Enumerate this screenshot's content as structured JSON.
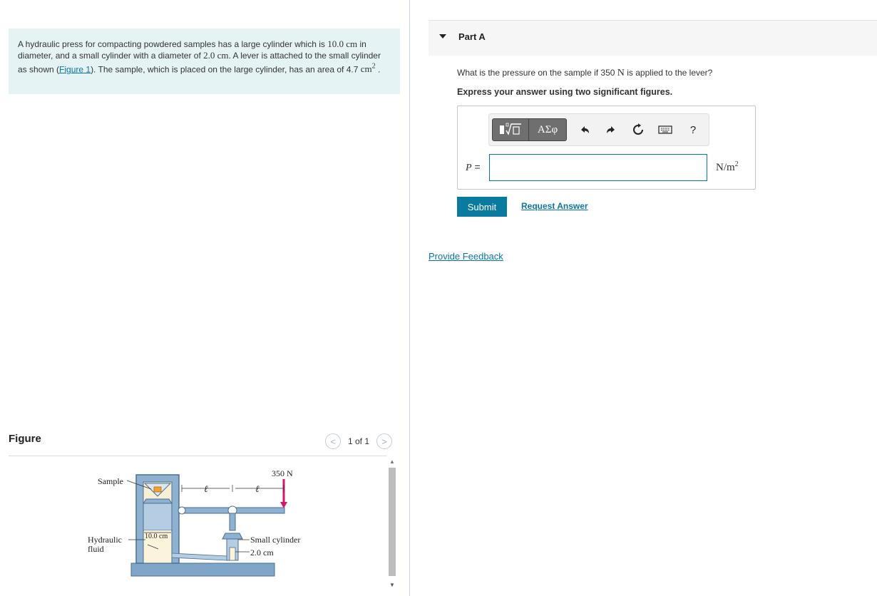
{
  "problem": {
    "text1": "A hydraulic press for compacting powdered samples has a large cylinder which is ",
    "large_diameter": "10.0 cm",
    "text2": " in diameter, and a small cylinder with a diameter of ",
    "small_diameter": "2.0 cm",
    "text3": ". A lever is attached to the small cylinder as shown (",
    "figure_link": "Figure 1",
    "text4": "). The sample, which is placed on the large cylinder, has an area of 4.7 ",
    "area_unit": "cm",
    "area_exp": "2",
    "text5": " ."
  },
  "figure": {
    "title": "Figure",
    "nav_prev": "<",
    "nav_next": ">",
    "count": "1 of 1",
    "labels": {
      "force": "350 N",
      "sample": "Sample",
      "ell1": "ℓ",
      "ell2": "ℓ",
      "hydraulic": "Hydraulic",
      "fluid": "fluid",
      "large_dim": "10.0 cm",
      "small_cylinder": "Small cylinder",
      "small_dim": "2.0 cm"
    }
  },
  "part": {
    "title": "Part A",
    "question_pre": "What is the pressure on the sample if 350 ",
    "question_unit": "N",
    "question_post": " is applied to the lever?",
    "instruction": "Express your answer using two significant figures.",
    "toolbar": {
      "greek": "ΑΣφ",
      "help": "?"
    },
    "variable": "P",
    "equals": " =",
    "input_value": "",
    "unit_base": "N/m",
    "unit_exp": "2",
    "submit": "Submit",
    "request": "Request Answer"
  },
  "feedback": "Provide Feedback",
  "colors": {
    "accent": "#0a76a8",
    "submit_bg": "#0a7ba0",
    "problem_bg": "#e6f3f4",
    "force_arrow": "#d0186e"
  }
}
